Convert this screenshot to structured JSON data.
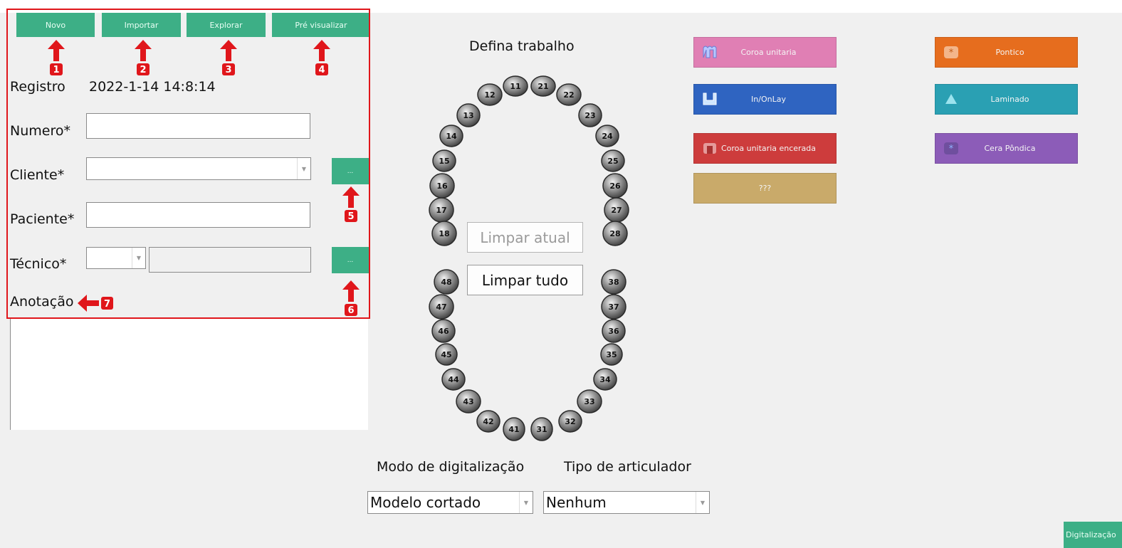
{
  "toolbar": {
    "new_label": "Novo",
    "import_label": "Importar",
    "explore_label": "Explorar",
    "preview_label": "Pré visualizar"
  },
  "annotations": [
    "1",
    "2",
    "3",
    "4",
    "5",
    "6",
    "7"
  ],
  "form": {
    "registro_label": "Registro",
    "registro_value": "2022-1-14 14:8:14",
    "numero_label": "Numero*",
    "numero_value": "",
    "cliente_label": "Cliente*",
    "cliente_value": "",
    "cliente_browse": "...",
    "paciente_label": "Paciente*",
    "paciente_value": "",
    "tecnico_label": "Técnico*",
    "tecnico_browse": "...",
    "anotacao_label": "Anotação"
  },
  "center": {
    "title": "Defina trabalho",
    "clear_current": "Limpar atual",
    "clear_all": "Limpar tudo",
    "upper_teeth": [
      "11",
      "12",
      "13",
      "14",
      "15",
      "16",
      "17",
      "18",
      "21",
      "22",
      "23",
      "24",
      "25",
      "26",
      "27",
      "28"
    ],
    "lower_teeth": [
      "31",
      "32",
      "33",
      "34",
      "35",
      "36",
      "37",
      "38",
      "41",
      "42",
      "43",
      "44",
      "45",
      "46",
      "47",
      "48"
    ]
  },
  "scan_mode": {
    "label": "Modo de digitalização",
    "value": "Modelo cortado"
  },
  "articulator": {
    "label": "Tipo de articulador",
    "value": "Nenhum"
  },
  "work_types": [
    {
      "label": "Coroa unitaria",
      "color": "#e07fb4",
      "icon": "crown-icon"
    },
    {
      "label": "In/OnLay",
      "color": "#2f64c1",
      "icon": "inlay-icon"
    },
    {
      "label": "Coroa unitaria encerada",
      "color": "#cd3c3c",
      "icon": "wax-crown-icon"
    },
    {
      "label": "???",
      "color": "#c9aa6a",
      "icon": ""
    },
    {
      "label": "Pontico",
      "color": "#e66d1e",
      "icon": "pontic-icon"
    },
    {
      "label": "Laminado",
      "color": "#2aa0b3",
      "icon": "veneer-icon"
    },
    {
      "label": "Cera Pôndica",
      "color": "#8c5cb8",
      "icon": "wax-pontic-icon"
    }
  ],
  "scan_button": {
    "label": "Digitalização"
  }
}
